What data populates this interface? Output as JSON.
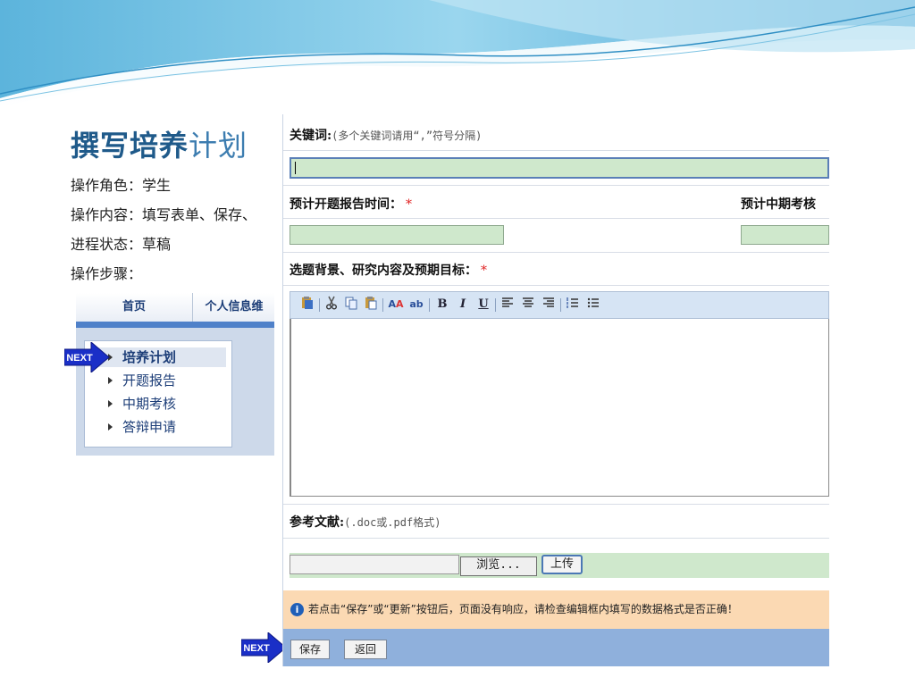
{
  "slide": {
    "title_bold": "撰写培养",
    "title_light": "计划",
    "role": "操作角色：学生",
    "content": "操作内容：填写表单、保存、",
    "status": "进程状态：草稿",
    "steps": "操作步骤："
  },
  "nav": {
    "tabs": [
      "首页",
      "个人信息维"
    ],
    "menu": [
      {
        "label": "培养计划",
        "active": true
      },
      {
        "label": "开题报告",
        "active": false
      },
      {
        "label": "中期考核",
        "active": false
      },
      {
        "label": "答辩申请",
        "active": false
      }
    ]
  },
  "next_label": "NEXT",
  "form": {
    "keywords_label": "关键词:",
    "keywords_hint": "(多个关键词请用“,”符号分隔)",
    "keywords_value": "",
    "opening_label": "预计开题报告时间：",
    "midterm_label": "预计中期考核",
    "required_mark": "*",
    "background_label": "选题背景、研究内容及预期目标：",
    "toolbar_icons": [
      "paste-word-icon",
      "cut-icon",
      "copy-icon",
      "paste-icon",
      "find-icon",
      "replace-icon",
      "bold-icon",
      "italic-icon",
      "underline-icon",
      "align-left-icon",
      "align-center-icon",
      "align-right-icon",
      "ordered-list-icon",
      "unordered-list-icon"
    ],
    "toolbar_glyphs": {
      "bold": "B",
      "italic": "I",
      "underline": "U"
    },
    "references_label": "参考文献:",
    "references_hint": "(.doc或.pdf格式)",
    "browse_label": "浏览...",
    "upload_label": "上传",
    "notice": "若点击“保存”或“更新”按钮后，页面没有响应，请检查编辑框内填写的数据格式是否正确！",
    "save_label": "保存",
    "back_label": "返回"
  },
  "colors": {
    "title": "#1f5a8a",
    "nav_bar": "#4f81c9",
    "input_green": "#cfe8cc",
    "notice_bg": "#fbd9b3",
    "action_bar": "#8fb0dc",
    "next_arrow": "#1a2fc7"
  }
}
